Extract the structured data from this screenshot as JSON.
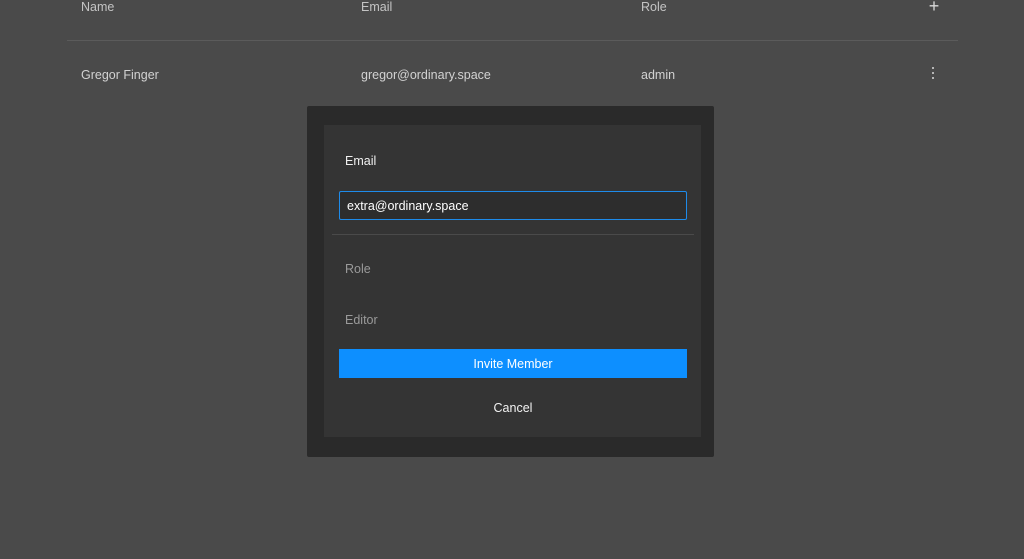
{
  "table": {
    "headers": {
      "name": "Name",
      "email": "Email",
      "role": "Role"
    },
    "add_icon": "plus-icon",
    "rows": [
      {
        "name": "Gregor Finger",
        "email": "gregor@ordinary.space",
        "role": "admin",
        "menu_icon": "more-vertical-icon"
      }
    ]
  },
  "invite_dialog": {
    "email_label": "Email",
    "email_value": "extra@ordinary.space",
    "role_label": "Role",
    "role_value": "Editor",
    "invite_label": "Invite Member",
    "cancel_label": "Cancel"
  },
  "colors": {
    "background": "#4a4a4a",
    "modal_frame": "#2a2a2a",
    "modal": "#343434",
    "accent": "#0d8fff",
    "input_focus_border": "#1e8bea"
  }
}
